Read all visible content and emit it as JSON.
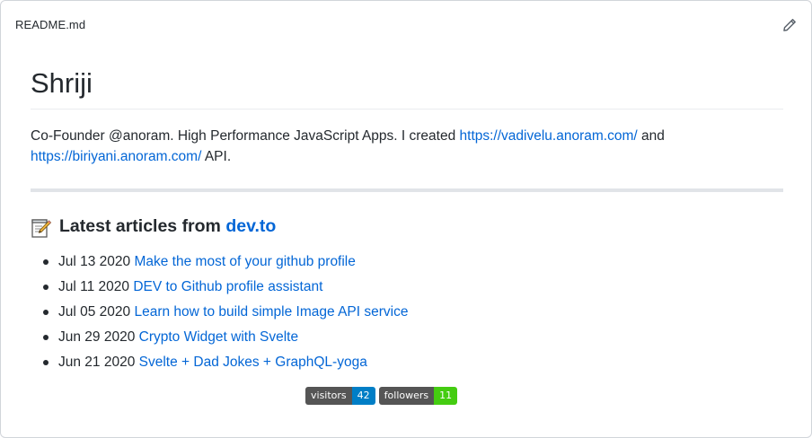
{
  "header": {
    "filename": "README.md",
    "edit_icon": "pencil-icon"
  },
  "profile": {
    "title": "Shriji",
    "bio_prefix": "Co-Founder @anoram. High Performance JavaScript Apps. I created ",
    "bio_link1": "https://vadivelu.anoram.com/",
    "bio_and": " and",
    "bio_link2": "https://biriyani.anoram.com/",
    "bio_suffix": " API."
  },
  "articles": {
    "heading_prefix": "Latest articles from ",
    "heading_link": "dev.to",
    "heading_icon": "memo-icon",
    "items": [
      {
        "date": "Jul 13 2020",
        "title": "Make the most of your github profile"
      },
      {
        "date": "Jul 11 2020",
        "title": "DEV to Github profile assistant"
      },
      {
        "date": "Jul 05 2020",
        "title": "Learn how to build simple Image API service"
      },
      {
        "date": "Jun 29 2020",
        "title": "Crypto Widget with Svelte"
      },
      {
        "date": "Jun 21 2020",
        "title": "Svelte + Dad Jokes + GraphQL-yoga"
      }
    ]
  },
  "badges": [
    {
      "label": "visitors",
      "value": "42",
      "color": "#007ec6"
    },
    {
      "label": "followers",
      "value": "11",
      "color": "#4c1"
    }
  ],
  "colors": {
    "link": "#0366d6",
    "text": "#24292e",
    "border": "#d1d5da"
  }
}
